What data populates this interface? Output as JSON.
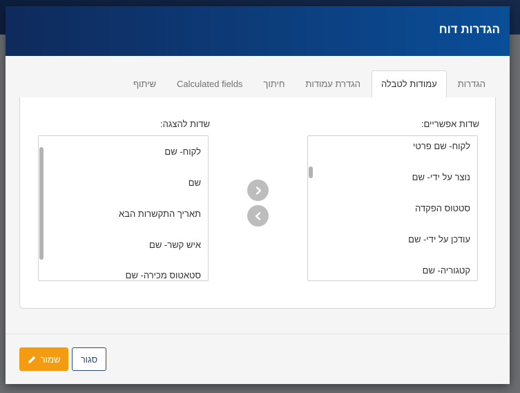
{
  "modal": {
    "title": "הגדרות דוח"
  },
  "tabs": [
    {
      "label": "הגדרות",
      "active": false
    },
    {
      "label": "עמודות לטבלה",
      "active": true
    },
    {
      "label": "הגדרת עמודות",
      "active": false
    },
    {
      "label": "חיתוך",
      "active": false
    },
    {
      "label": "Calculated fields",
      "active": false
    },
    {
      "label": "שיתוף",
      "active": false
    }
  ],
  "available": {
    "label": "שדות אפשריים:",
    "items": [
      "לקוח- שם פרטי",
      "נוצר על ידי- שם",
      "סטטוס הפקדה",
      "עודכן על ידי- שם",
      "קטגוריה- שם"
    ]
  },
  "display": {
    "label": "שדות להצגה:",
    "items": [
      "לקוח- שם",
      "שם",
      "תאריך התקשרות הבא",
      "איש קשר- שם",
      "סטאטוס מכירה- שם"
    ]
  },
  "buttons": {
    "save": "שמור",
    "close": "סגור"
  },
  "icons": {
    "move_right": "chevron-right-icon",
    "move_left": "chevron-left-icon",
    "save": "pencil-icon"
  },
  "colors": {
    "header": "#0a4e98",
    "save": "#f39c12",
    "close_border": "#2c4a79",
    "arrow_button": "#bdbdbd"
  }
}
